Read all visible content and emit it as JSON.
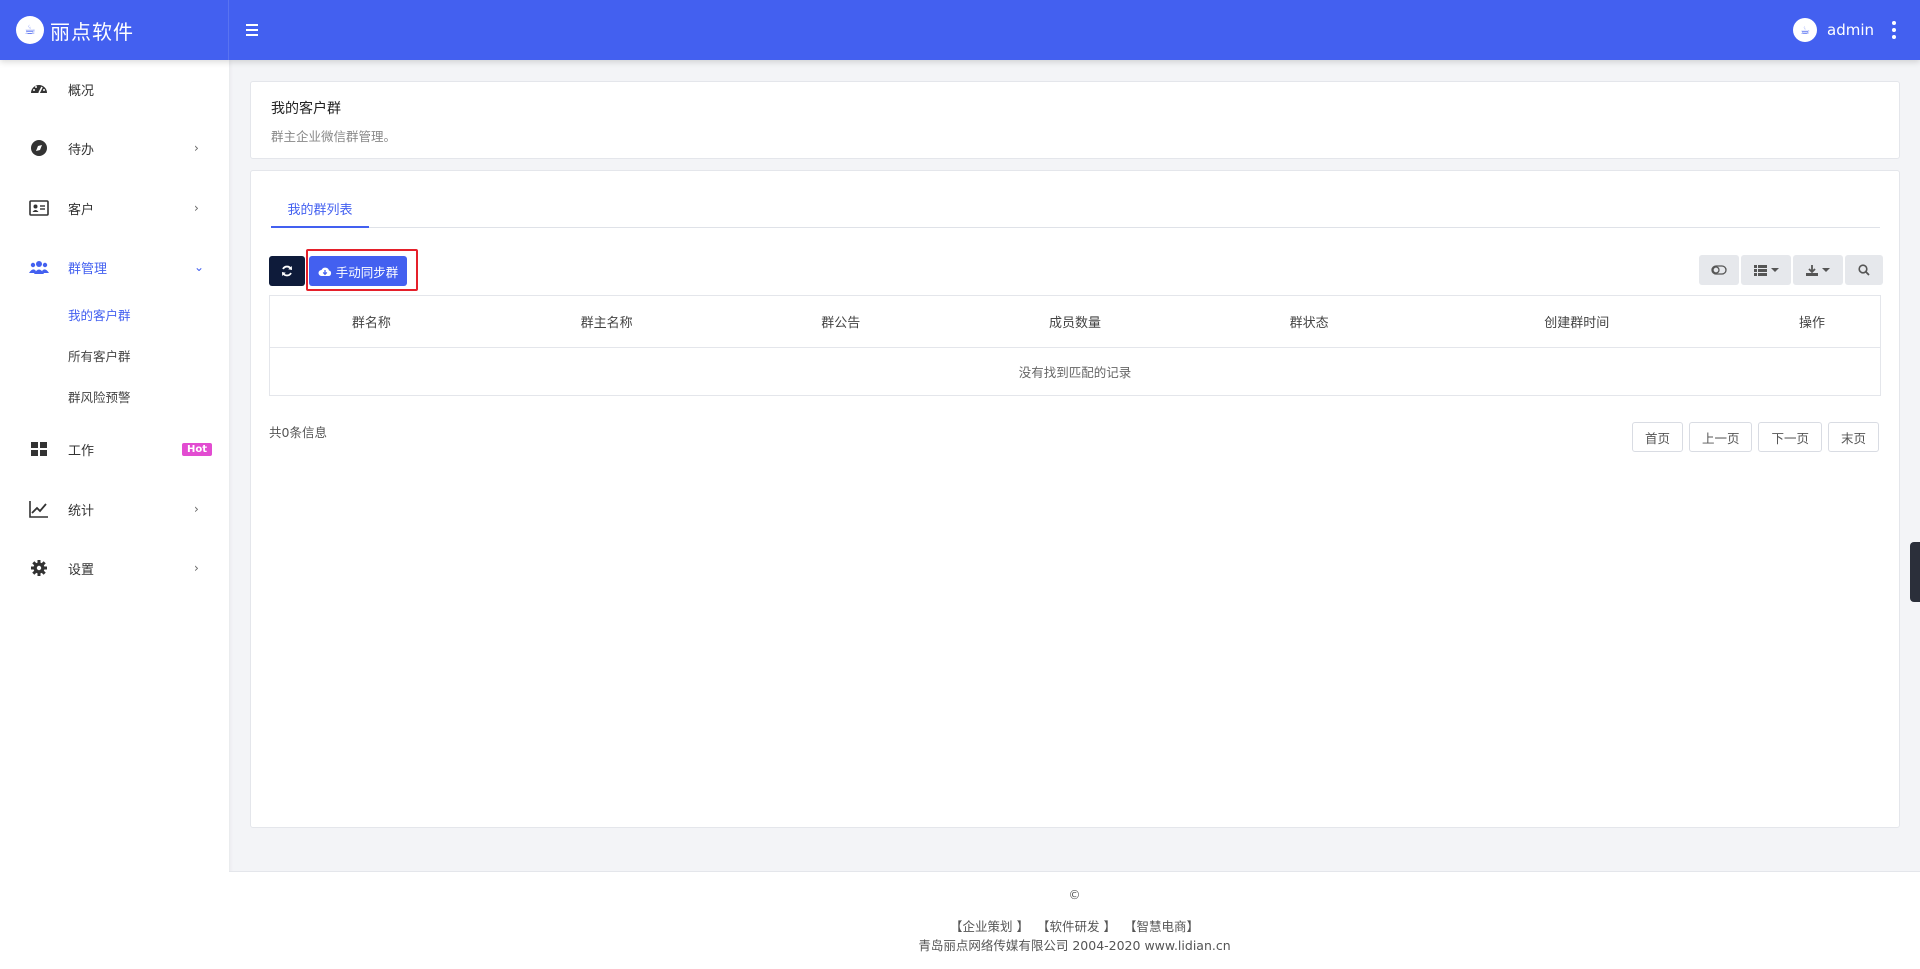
{
  "app": {
    "brand_name": "丽点软件",
    "username": "admin"
  },
  "sidebar": {
    "items": [
      {
        "label": "概况",
        "icon": "dashboard-icon"
      },
      {
        "label": "待办",
        "icon": "compass-icon"
      },
      {
        "label": "客户",
        "icon": "id-card-icon"
      },
      {
        "label": "群管理",
        "icon": "users-icon"
      },
      {
        "label": "工作",
        "icon": "grid-icon"
      },
      {
        "label": "统计",
        "icon": "chart-line-icon"
      },
      {
        "label": "设置",
        "icon": "gear-icon"
      }
    ],
    "sub_items": [
      "我的客户群",
      "所有客户群",
      "群风险预警"
    ],
    "hot_badge": "Hot"
  },
  "header_card": {
    "title": "我的客户群",
    "subtitle": "群主企业微信群管理。"
  },
  "tabs": [
    "我的群列表"
  ],
  "toolbar": {
    "sync_label": "手动同步群"
  },
  "table": {
    "columns": [
      "群名称",
      "群主名称",
      "群公告",
      "成员数量",
      "群状态",
      "创建群时间",
      "操作"
    ],
    "empty_text": "没有找到匹配的记录"
  },
  "pagination": {
    "total_info": "共0条信息",
    "first": "首页",
    "prev": "上一页",
    "next": "下一页",
    "last": "末页"
  },
  "footer": {
    "copyright": "©",
    "link1": "【企业策划 】",
    "link2": "【软件研发 】",
    "link3": "【智慧电商】",
    "company": "青岛丽点网络传媒有限公司 2004-2020 www.lidian.cn"
  },
  "colors": {
    "primary": "#4360f0",
    "dark_button": "#0e1b3a",
    "hot_badge": "#e24cd1",
    "highlight": "#e5202a"
  }
}
